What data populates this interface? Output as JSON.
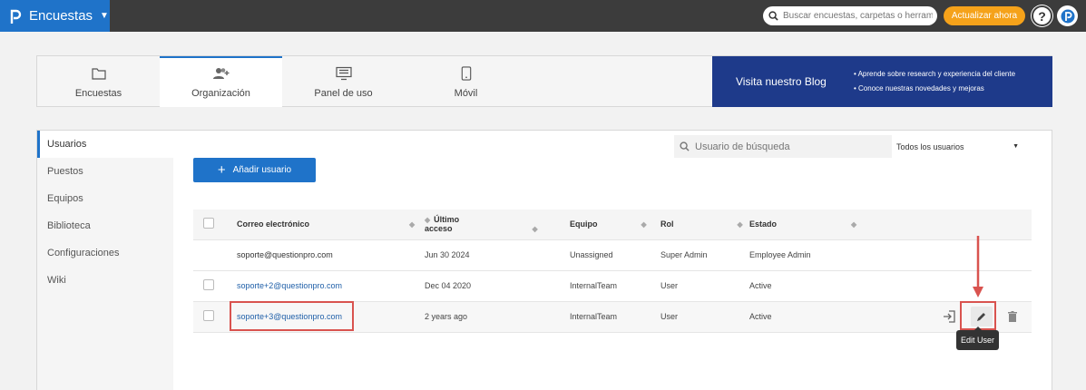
{
  "topbar": {
    "app_name": "Encuestas",
    "search_placeholder": "Buscar encuestas, carpetas o herrami",
    "upgrade_label": "Actualizar ahora",
    "help_label": "?",
    "brand_color": "#1f73c9",
    "accent_color": "#f5a21a"
  },
  "tabs": [
    {
      "label": "Encuestas",
      "icon": "folder-icon"
    },
    {
      "label": "Organización",
      "icon": "users-add-icon"
    },
    {
      "label": "Panel de uso",
      "icon": "monitor-icon"
    },
    {
      "label": "Móvil",
      "icon": "mobile-icon"
    }
  ],
  "blog": {
    "title": "Visita nuestro Blog",
    "bullets": [
      "Aprende sobre research y experiencia del cliente",
      "Conoce nuestras novedades y mejoras"
    ]
  },
  "sidebar": {
    "items": [
      {
        "label": "Usuarios"
      },
      {
        "label": "Puestos"
      },
      {
        "label": "Equipos"
      },
      {
        "label": "Biblioteca"
      },
      {
        "label": "Configuraciones"
      },
      {
        "label": "Wiki"
      }
    ]
  },
  "main": {
    "user_search_placeholder": "Usuario de búsqueda",
    "filter_value": "Todos los usuarios",
    "add_user_label": "Añadir usuario",
    "columns": [
      "Correo electrónico",
      "Último acceso",
      "Equipo",
      "Rol",
      "Estado"
    ],
    "rows": [
      {
        "email": "soporte@questionpro.com",
        "last_access": "Jun 30 2024",
        "team": "Unassigned",
        "role": "Super Admin",
        "status": "Employee Admin"
      },
      {
        "email": "soporte+2@questionpro.com",
        "last_access": "Dec 04 2020",
        "team": "InternalTeam",
        "role": "User",
        "status": "Active"
      },
      {
        "email": "soporte+3@questionpro.com",
        "last_access": "2 years ago",
        "team": "InternalTeam",
        "role": "User",
        "status": "Active"
      }
    ],
    "tooltip": "Edit User"
  }
}
